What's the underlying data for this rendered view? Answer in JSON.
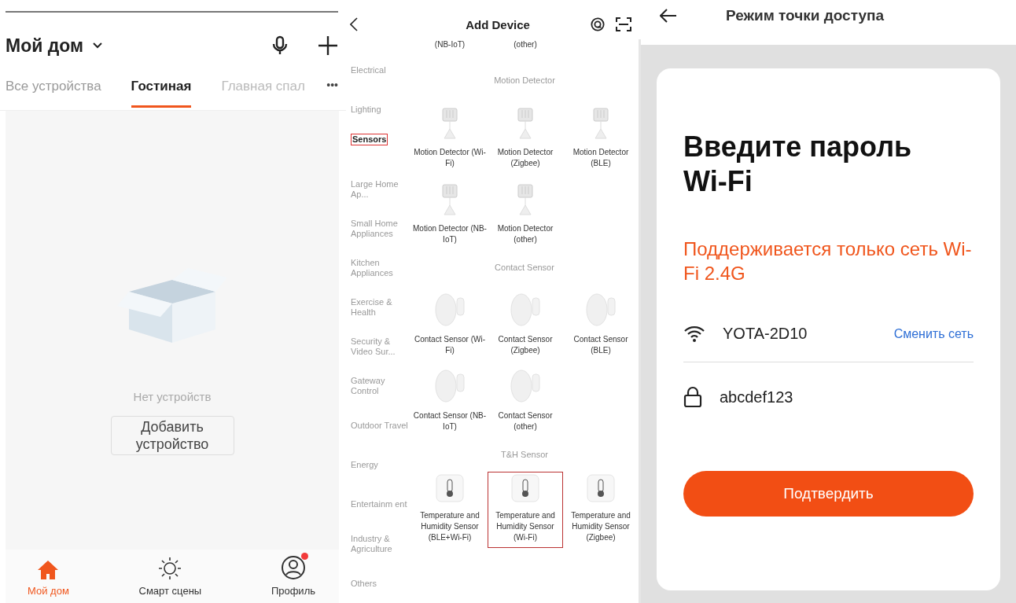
{
  "home": {
    "title": "Мой дом",
    "tabs": [
      {
        "label": "Все устройства",
        "selected": false
      },
      {
        "label": "Гостиная",
        "selected": true
      },
      {
        "label": "Главная спал",
        "selected": false
      }
    ],
    "more": "•••",
    "empty_text": "Нет устройств",
    "add_button": "Добавить устройство",
    "nav": [
      {
        "label": "Мой дом",
        "kind": "home",
        "selected": true,
        "badge": false
      },
      {
        "label": "Смарт сцены",
        "kind": "scenes",
        "selected": false,
        "badge": false
      },
      {
        "label": "Профиль",
        "kind": "profile",
        "selected": false,
        "badge": true
      }
    ]
  },
  "add_device": {
    "title": "Add Device",
    "categories": [
      {
        "label": "Electrical",
        "selected": false
      },
      {
        "label": "Lighting",
        "selected": false
      },
      {
        "label": "Sensors",
        "selected": true
      },
      {
        "label": "Large Home Ap...",
        "selected": false
      },
      {
        "label": "Small Home Appliances",
        "selected": false
      },
      {
        "label": "Kitchen Appliances",
        "selected": false
      },
      {
        "label": "Exercise & Health",
        "selected": false
      },
      {
        "label": "Security & Video Sur...",
        "selected": false
      },
      {
        "label": "Gateway Control",
        "selected": false
      },
      {
        "label": "Outdoor Travel",
        "selected": false
      },
      {
        "label": "Energy",
        "selected": false
      },
      {
        "label": "Entertainm ent",
        "selected": false
      },
      {
        "label": "Industry & Agriculture",
        "selected": false
      },
      {
        "label": "Others",
        "selected": false
      }
    ],
    "sections": [
      {
        "kind": "partial",
        "devices": [
          {
            "name": "(NB-IoT)",
            "highlighted": false
          },
          {
            "name": "(other)",
            "highlighted": false
          }
        ]
      },
      {
        "kind": "motion",
        "title": "Motion Detector",
        "devices": [
          {
            "name": "Motion Detector (Wi-Fi)",
            "highlighted": false
          },
          {
            "name": "Motion Detector (Zigbee)",
            "highlighted": false
          },
          {
            "name": "Motion Detector (BLE)",
            "highlighted": false
          },
          {
            "name": "Motion Detector (NB-IoT)",
            "highlighted": false
          },
          {
            "name": "Motion Detector (other)",
            "highlighted": false
          }
        ]
      },
      {
        "kind": "contact",
        "title": "Contact Sensor",
        "devices": [
          {
            "name": "Contact Sensor (Wi-Fi)",
            "highlighted": false
          },
          {
            "name": "Contact Sensor (Zigbee)",
            "highlighted": false
          },
          {
            "name": "Contact Sensor (BLE)",
            "highlighted": false
          },
          {
            "name": "Contact Sensor (NB-IoT)",
            "highlighted": false
          },
          {
            "name": "Contact Sensor (other)",
            "highlighted": false
          }
        ]
      },
      {
        "kind": "thermo",
        "title": "T&H Sensor",
        "devices": [
          {
            "name": "Temperature and Humidity Sensor (BLE+Wi-Fi)",
            "highlighted": false
          },
          {
            "name": "Temperature and Humidity Sensor (Wi-Fi)",
            "highlighted": true
          },
          {
            "name": "Temperature and Humidity Sensor (Zigbee)",
            "highlighted": false
          }
        ]
      }
    ]
  },
  "hotspot": {
    "title": "Режим точки доступа",
    "heading": "Введите пароль Wi-Fi",
    "notice": "Поддерживается только сеть Wi-Fi 2.4G",
    "ssid": "YOTA-2D10",
    "change_link": "Сменить сеть",
    "password": "abcdef123",
    "confirm_button": "Подтвердить"
  }
}
